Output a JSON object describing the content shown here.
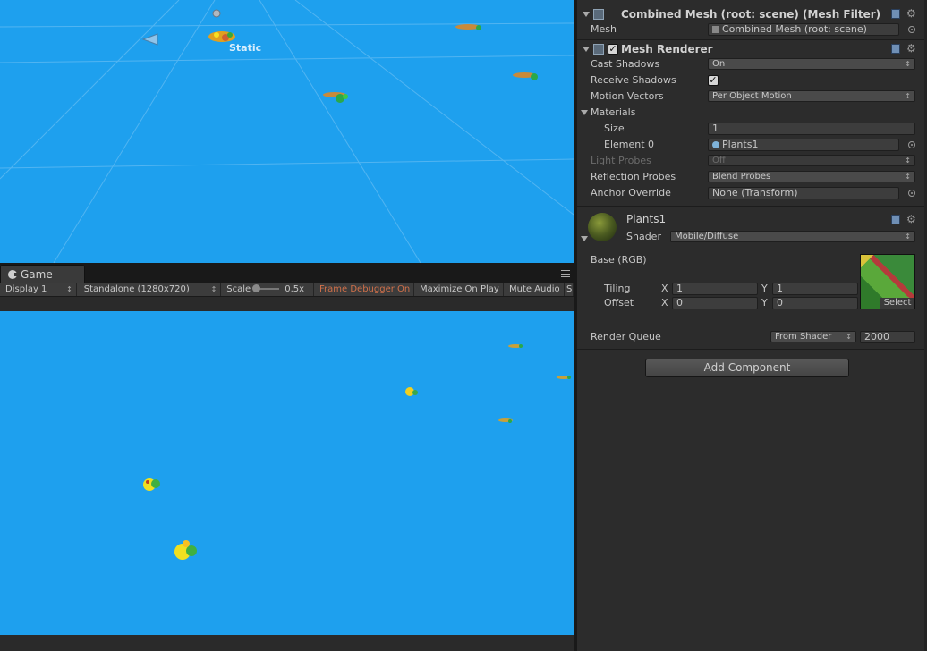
{
  "scene": {
    "static_label": "Static"
  },
  "game": {
    "tab_label": "Game",
    "toolbar": {
      "display": "Display 1",
      "resolution": "Standalone (1280x720)",
      "scale_label": "Scale",
      "scale_value": "0.5x",
      "frame_debugger": "Frame Debugger On",
      "maximize_on_play": "Maximize On Play",
      "mute_audio": "Mute Audio",
      "stats_truncated": "S"
    }
  },
  "inspector": {
    "mesh_filter": {
      "title": "Combined Mesh (root: scene) (Mesh Filter)",
      "mesh_label": "Mesh",
      "mesh_value": "Combined Mesh (root: scene)"
    },
    "mesh_renderer": {
      "title": "Mesh Renderer",
      "enabled": true,
      "cast_shadows_label": "Cast Shadows",
      "cast_shadows_value": "On",
      "receive_shadows_label": "Receive Shadows",
      "receive_shadows_checked": true,
      "motion_vectors_label": "Motion Vectors",
      "motion_vectors_value": "Per Object Motion",
      "materials_label": "Materials",
      "size_label": "Size",
      "size_value": "1",
      "element0_label": "Element 0",
      "element0_value": "Plants1",
      "light_probes_label": "Light Probes",
      "light_probes_value": "Off",
      "reflection_probes_label": "Reflection Probes",
      "reflection_probes_value": "Blend Probes",
      "anchor_override_label": "Anchor Override",
      "anchor_override_value": "None (Transform)"
    },
    "material": {
      "name": "Plants1",
      "shader_label": "Shader",
      "shader_value": "Mobile/Diffuse",
      "base_label": "Base (RGB)",
      "tiling_label": "Tiling",
      "offset_label": "Offset",
      "x_label": "X",
      "y_label": "Y",
      "tiling_x": "1",
      "tiling_y": "1",
      "offset_x": "0",
      "offset_y": "0",
      "select_label": "Select",
      "render_queue_label": "Render Queue",
      "render_queue_mode": "From Shader",
      "render_queue_value": "2000"
    },
    "add_component_label": "Add Component"
  },
  "colors": {
    "sky": "#1ea0ee",
    "panel": "#2c2c2c",
    "frame_debugger_accent": "#d0704a"
  }
}
